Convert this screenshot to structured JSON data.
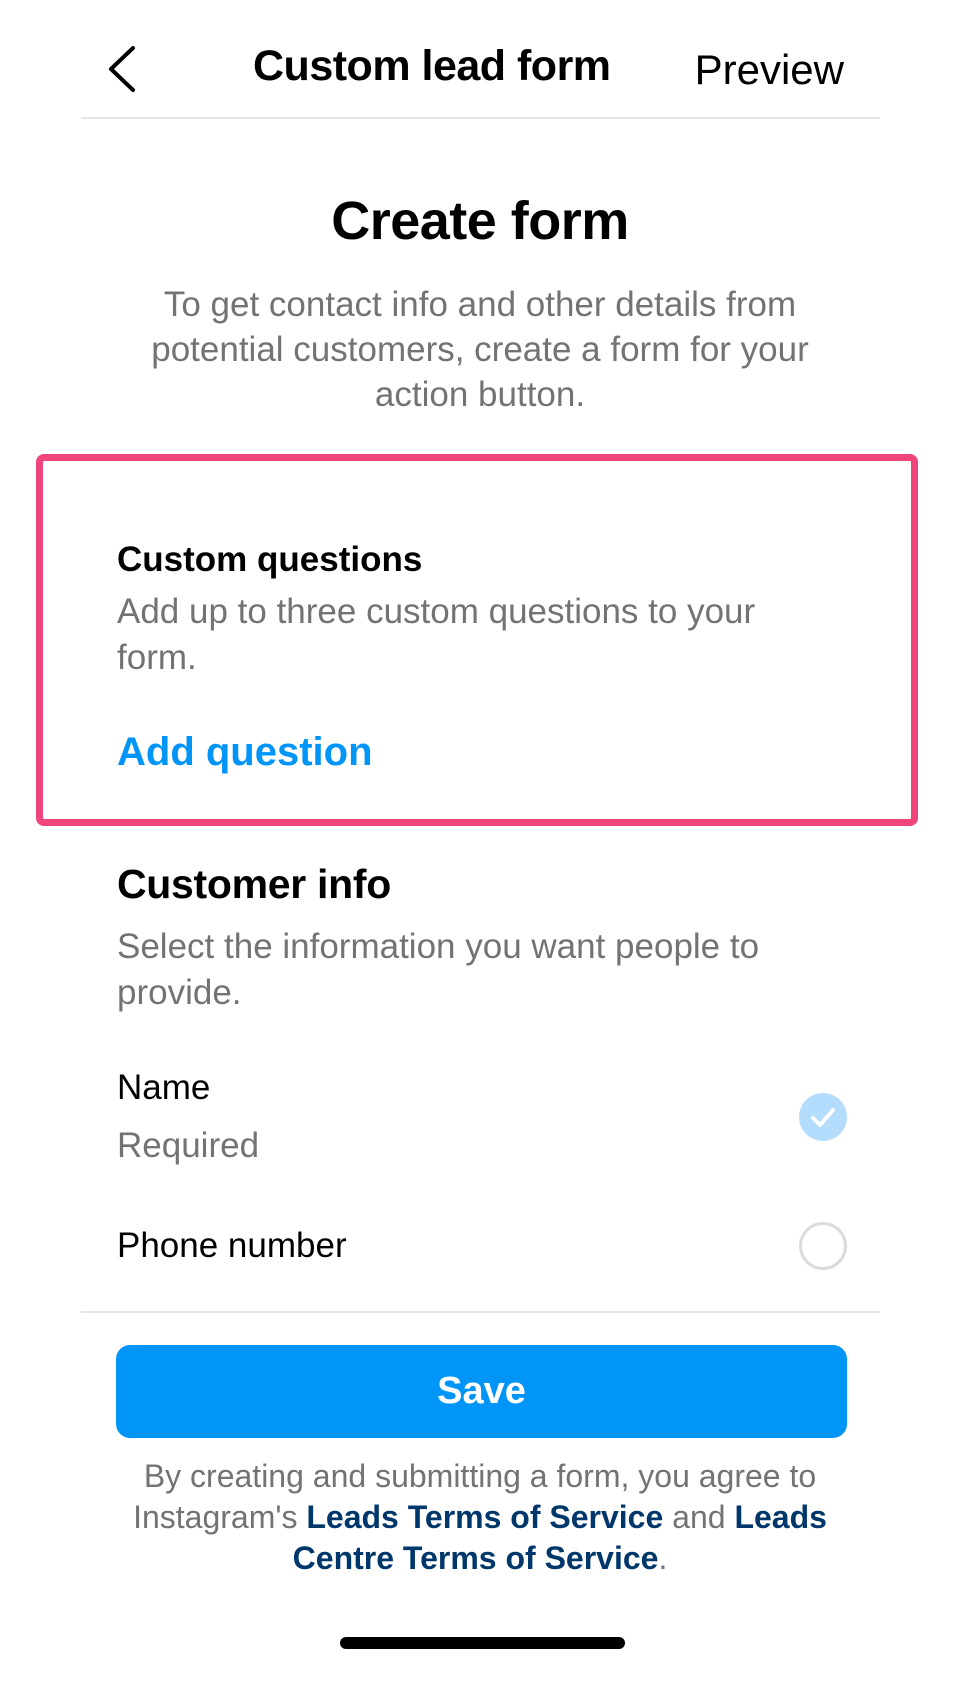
{
  "header": {
    "back_icon": "chevron-left-icon",
    "title": "Custom lead form",
    "preview_label": "Preview"
  },
  "main": {
    "title": "Create form",
    "description": "To get contact info and other details from potential customers, create a form for your action button."
  },
  "custom_questions": {
    "heading": "Custom questions",
    "description": "Add up to three custom questions to your form.",
    "add_label": "Add question",
    "highlight_color": "#f0457a"
  },
  "customer_info": {
    "heading": "Customer info",
    "description": "Select the information you want people to provide.",
    "options": [
      {
        "label": "Name",
        "sublabel": "Required",
        "checked": true,
        "icon": "checkmark-icon"
      },
      {
        "label": "Phone number",
        "sublabel": "",
        "checked": false,
        "icon": "empty-circle-icon"
      }
    ]
  },
  "footer": {
    "save_label": "Save",
    "legal_prefix": "By creating and submitting a form, you agree to Instagram's",
    "legal_link_1": "Leads Terms of Service",
    "legal_and": "and",
    "legal_link_2": "Leads Centre Terms of Service",
    "legal_suffix": "."
  },
  "colors": {
    "accent": "#0095f6",
    "link_dark": "#00376b",
    "secondary_text": "#737373",
    "checked_fill": "#b3dcfd"
  }
}
